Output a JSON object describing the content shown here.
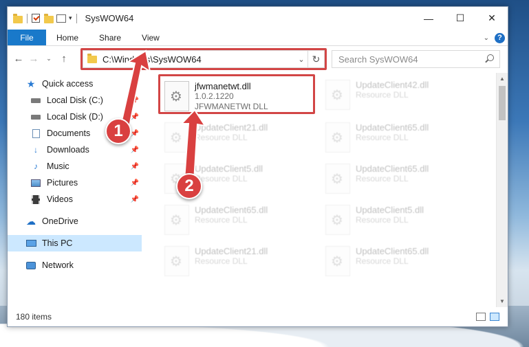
{
  "window": {
    "title": "SysWOW64"
  },
  "ribbon": {
    "tabs": [
      "File",
      "Home",
      "Share",
      "View"
    ],
    "help_label": "?"
  },
  "address": {
    "path": "C:\\Windows\\SysWOW64",
    "search_placeholder": "Search SysWOW64"
  },
  "sidebar": {
    "items": [
      {
        "label": "Quick access",
        "icon": "star-icon"
      },
      {
        "label": "Local Disk (C:)",
        "icon": "drive-icon"
      },
      {
        "label": "Local Disk (D:)",
        "icon": "drive-icon"
      },
      {
        "label": "Documents",
        "icon": "documents-icon"
      },
      {
        "label": "Downloads",
        "icon": "downloads-icon"
      },
      {
        "label": "Music",
        "icon": "music-icon"
      },
      {
        "label": "Pictures",
        "icon": "pictures-icon"
      },
      {
        "label": "Videos",
        "icon": "videos-icon"
      },
      {
        "label": "OneDrive",
        "icon": "cloud-icon"
      },
      {
        "label": "This PC",
        "icon": "computer-icon"
      },
      {
        "label": "Network",
        "icon": "network-icon"
      }
    ]
  },
  "files": [
    {
      "name": "jfwmanetwt.dll",
      "version": "1.0.2.1220",
      "desc": "JFWMANETWt DLL"
    },
    {
      "name": "UpdateClient42.dll",
      "version": "Resource DLL"
    },
    {
      "name": "UpdateClient21.dll",
      "version": "Resource DLL"
    },
    {
      "name": "UpdateClient65.dll",
      "version": "Resource DLL"
    },
    {
      "name": "UpdateClient5.dll",
      "version": "Resource DLL"
    },
    {
      "name": "UpdateClient65.dll",
      "version": "Resource DLL"
    },
    {
      "name": "UpdateClient65.dll",
      "version": "Resource DLL"
    },
    {
      "name": "UpdateClient5.dll",
      "version": "Resource DLL"
    },
    {
      "name": "UpdateClient21.dll",
      "version": "Resource DLL"
    },
    {
      "name": "UpdateClient65.dll",
      "version": "Resource DLL"
    }
  ],
  "status": {
    "item_count": "180 items"
  },
  "annotations": {
    "step1": "1",
    "step2": "2"
  },
  "colors": {
    "accent": "#1979ca",
    "highlight_box": "#d24545",
    "selected_nav": "#cce8ff"
  }
}
